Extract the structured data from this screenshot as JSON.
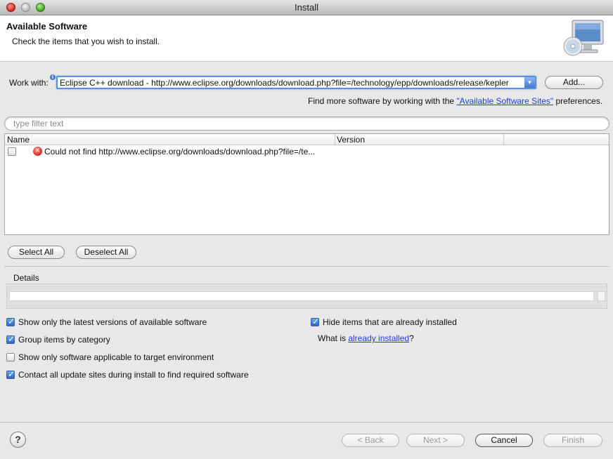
{
  "window": {
    "title": "Install"
  },
  "banner": {
    "title": "Available Software",
    "description": "Check the items that you wish to install.",
    "icon": "computer-with-cd-icon"
  },
  "work_with": {
    "label": "Work with:",
    "value": "Eclipse C++ download - http://www.eclipse.org/downloads/download.php?file=/technology/epp/downloads/release/kepler",
    "add_button": "Add..."
  },
  "find_more": {
    "prefix": "Find more software by working with the ",
    "link": "\"Available Software Sites\"",
    "suffix": " preferences."
  },
  "filter": {
    "placeholder": "type filter text"
  },
  "table": {
    "columns": [
      "Name",
      "Version"
    ],
    "rows": [
      {
        "checked": false,
        "status_icon": "error-icon",
        "name": "Could not find http://www.eclipse.org/downloads/download.php?file=/te...",
        "version": ""
      }
    ]
  },
  "selection_buttons": {
    "select_all": "Select All",
    "deselect_all": "Deselect All"
  },
  "details": {
    "label": "Details",
    "value": ""
  },
  "options": {
    "show_latest": {
      "label": "Show only the latest versions of available software",
      "checked": true
    },
    "group_by_category": {
      "label": "Group items by category",
      "checked": true
    },
    "show_applicable": {
      "label": "Show only software applicable to target environment",
      "checked": false
    },
    "contact_all_sites": {
      "label": "Contact all update sites during install to find required software",
      "checked": true
    },
    "hide_installed": {
      "label": "Hide items that are already installed",
      "checked": true
    },
    "what_is": {
      "prefix": "What is ",
      "link": "already installed",
      "suffix": "?"
    }
  },
  "footer": {
    "help_icon": "help-icon",
    "back": "< Back",
    "next": "Next >",
    "cancel": "Cancel",
    "finish": "Finish"
  }
}
